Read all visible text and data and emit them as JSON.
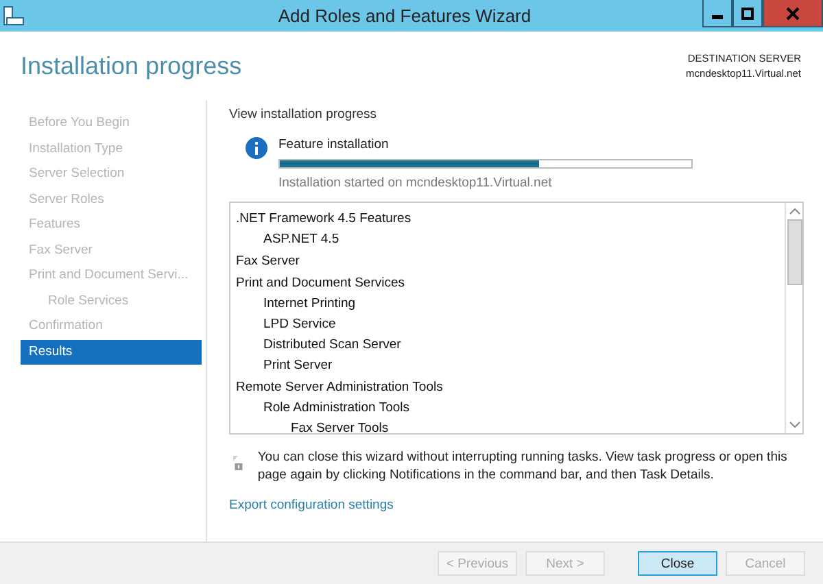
{
  "window": {
    "title": "Add Roles and Features Wizard"
  },
  "header": {
    "title": "Installation progress",
    "destination_label": "DESTINATION SERVER",
    "destination_server": "mcndesktop11.Virtual.net"
  },
  "sidebar": {
    "items": [
      {
        "label": "Before You Begin",
        "selected": false
      },
      {
        "label": "Installation Type",
        "selected": false
      },
      {
        "label": "Server Selection",
        "selected": false
      },
      {
        "label": "Server Roles",
        "selected": false
      },
      {
        "label": "Features",
        "selected": false
      },
      {
        "label": "Fax Server",
        "selected": false
      },
      {
        "label": "Print and Document Servi...",
        "selected": false,
        "children": [
          {
            "label": "Role Services",
            "selected": false
          }
        ]
      },
      {
        "label": "Confirmation",
        "selected": false
      },
      {
        "label": "Results",
        "selected": true
      }
    ]
  },
  "content": {
    "heading": "View installation progress",
    "progress": {
      "title": "Feature installation",
      "level": 0.63,
      "status": "Installation started on mcndesktop11.Virtual.net"
    },
    "results": [
      {
        "label": ".NET Framework 4.5 Features",
        "children": [
          {
            "label": "ASP.NET 4.5"
          }
        ]
      },
      {
        "label": "Fax Server"
      },
      {
        "label": "Print and Document Services",
        "children": [
          {
            "label": "Internet Printing"
          },
          {
            "label": "LPD Service"
          },
          {
            "label": "Distributed Scan Server"
          },
          {
            "label": "Print Server"
          }
        ]
      },
      {
        "label": "Remote Server Administration Tools",
        "children": [
          {
            "label": "Role Administration Tools",
            "children": [
              {
                "label": "Fax Server Tools"
              }
            ]
          }
        ]
      }
    ],
    "note": "You can close this wizard without interrupting running tasks. View task progress or open this page again by clicking Notifications in the command bar, and then Task Details.",
    "export_link": "Export configuration settings"
  },
  "buttons": [
    {
      "label": "< Previous",
      "disabled": true,
      "default": false
    },
    {
      "label": "Next >",
      "disabled": true,
      "default": false
    },
    {
      "label": "Close",
      "disabled": false,
      "default": true
    },
    {
      "label": "Cancel",
      "disabled": true,
      "default": false
    }
  ]
}
